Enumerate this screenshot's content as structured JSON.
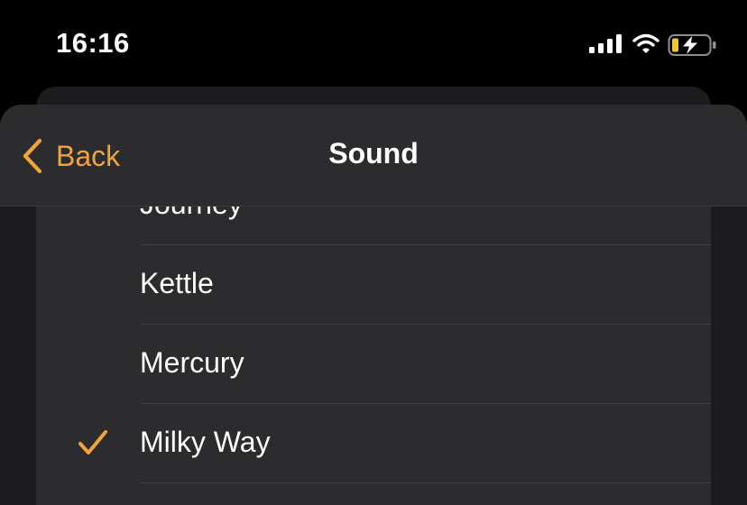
{
  "status_bar": {
    "time": "16:16",
    "icons": [
      "cellular-signal-icon",
      "wifi-icon",
      "battery-charging-icon"
    ],
    "battery_color": "#f5c518"
  },
  "nav": {
    "back_label": "Back",
    "title": "Sound",
    "accent_color": "#f2a33a"
  },
  "sounds": [
    {
      "label": "Journey",
      "selected": false
    },
    {
      "label": "Kettle",
      "selected": false
    },
    {
      "label": "Mercury",
      "selected": false
    },
    {
      "label": "Milky Way",
      "selected": true
    }
  ]
}
